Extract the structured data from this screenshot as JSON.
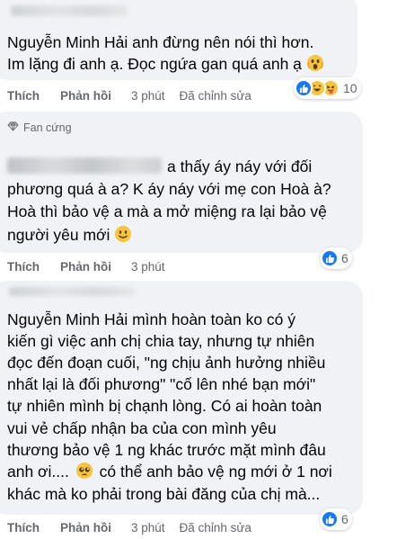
{
  "comments": [
    {
      "lines": [
        "Nguyễn Minh Hải anh đừng nên nói thì hơn.",
        "Im lặng đi anh ạ. Đọc ngứa gan quá anh ạ"
      ],
      "actions": {
        "like": "Thích",
        "reply": "Phản hồi",
        "time": "3 phút",
        "edited": "Đã chỉnh sửa"
      },
      "reactions": {
        "icons": [
          "like-icon",
          "haha-icon",
          "tongue-icon"
        ],
        "count": "10"
      }
    },
    {
      "badge": "Fan cứng",
      "lines": [
        "a thấy áy náy với đối",
        "phương quá à a? K áy náy với mẹ con Hoà à?",
        "Hoà thì bảo vệ a mà a mở miệng ra lại bảo vệ",
        "người yêu mới"
      ],
      "actions": {
        "like": "Thích",
        "reply": "Phản hồi",
        "time": "3 phút"
      },
      "reactions": {
        "icons": [
          "like-icon"
        ],
        "count": "6"
      }
    },
    {
      "lines": [
        "Nguyễn Minh Hải mình hoàn toàn ko có ý",
        "kiến gì việc anh chị chia tay, nhưng tự nhiên",
        "đọc đến đoạn cuối, \"ng chịu ảnh hưởng nhiều",
        "nhất lại là đối phương\" \"cố lên nhé bạn mới\"",
        "tự nhiên mình bị chạnh lòng. Có ai hoàn toàn",
        "vui vẻ chấp nhận ba của con mình yêu",
        "thương bảo vệ 1 ng khác trước mặt mình đâu",
        "anh ơi....",
        "có thể anh bảo vệ ng mới ở 1 nơi",
        "khác mà ko phải trong bài đăng của chị mà..."
      ],
      "actions": {
        "like": "Thích",
        "reply": "Phản hồi",
        "time": "3 phút",
        "edited": "Đã chỉnh sửa"
      },
      "reactions": {
        "icons": [
          "like-icon"
        ],
        "count": "6"
      }
    }
  ],
  "colors": {
    "bubble": "#f0f2f5",
    "meta": "#65676b",
    "like_blue": "#1877f2",
    "haha_yellow": "#f7c43d"
  }
}
